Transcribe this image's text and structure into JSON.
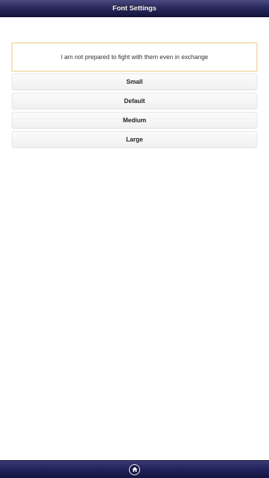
{
  "header": {
    "title": "Font Settings"
  },
  "preview": {
    "text": "I am not prepared to fight with them even in exchange"
  },
  "font_sizes": [
    {
      "label": "Small"
    },
    {
      "label": "Default"
    },
    {
      "label": "Medium"
    },
    {
      "label": "Large"
    }
  ],
  "footer": {
    "home_icon": "home-icon"
  },
  "colors": {
    "header_bar": "#2a2a5e",
    "preview_border": "#e6c77a",
    "button_background": "#f5f5f5"
  }
}
